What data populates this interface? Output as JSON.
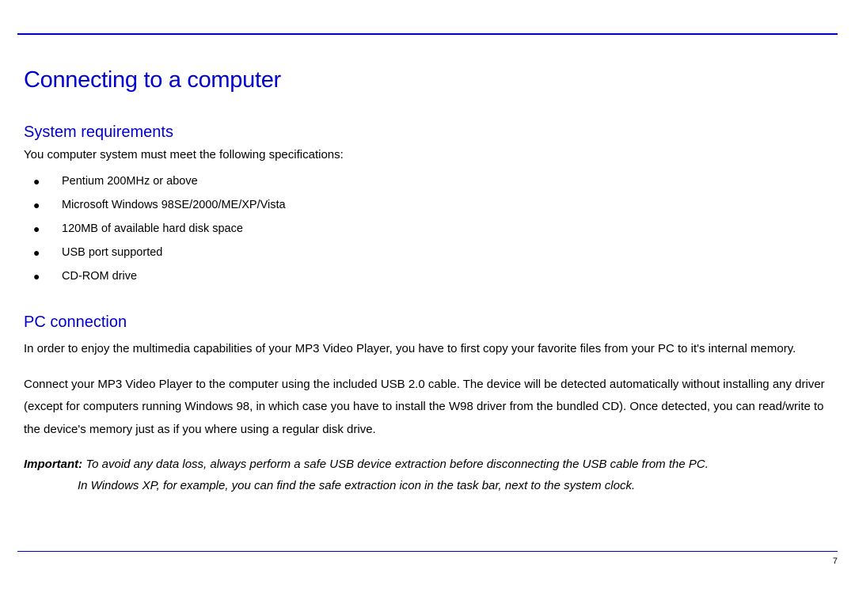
{
  "page": {
    "title": "Connecting to a computer",
    "section1": {
      "heading": "System requirements",
      "intro": "You computer system must meet the following specifications:",
      "items": [
        "Pentium 200MHz or above",
        "Microsoft Windows 98SE/2000/ME/XP/Vista",
        "120MB of available hard disk space",
        "USB port supported",
        "CD-ROM drive"
      ]
    },
    "section2": {
      "heading": "PC connection",
      "para1": "In order to enjoy the multimedia capabilities of your MP3 Video Player, you have to first copy your favorite files from your PC to it's internal memory.",
      "para2": "Connect your MP3 Video Player to the computer using the included USB 2.0 cable.  The device will be detected automatically without installing any driver (except for computers running Windows 98, in which case you have to install the W98 driver from the bundled CD).  Once detected, you can read/write to the device's memory just as if you where using a regular disk drive.",
      "important_label": "Important:",
      "important_line1": " To avoid any data loss, always perform a safe USB device extraction before disconnecting the USB cable from the PC.",
      "important_line2": "In Windows XP, for example, you can find the safe extraction icon in the task bar, next to the system clock."
    },
    "page_number": "7"
  }
}
